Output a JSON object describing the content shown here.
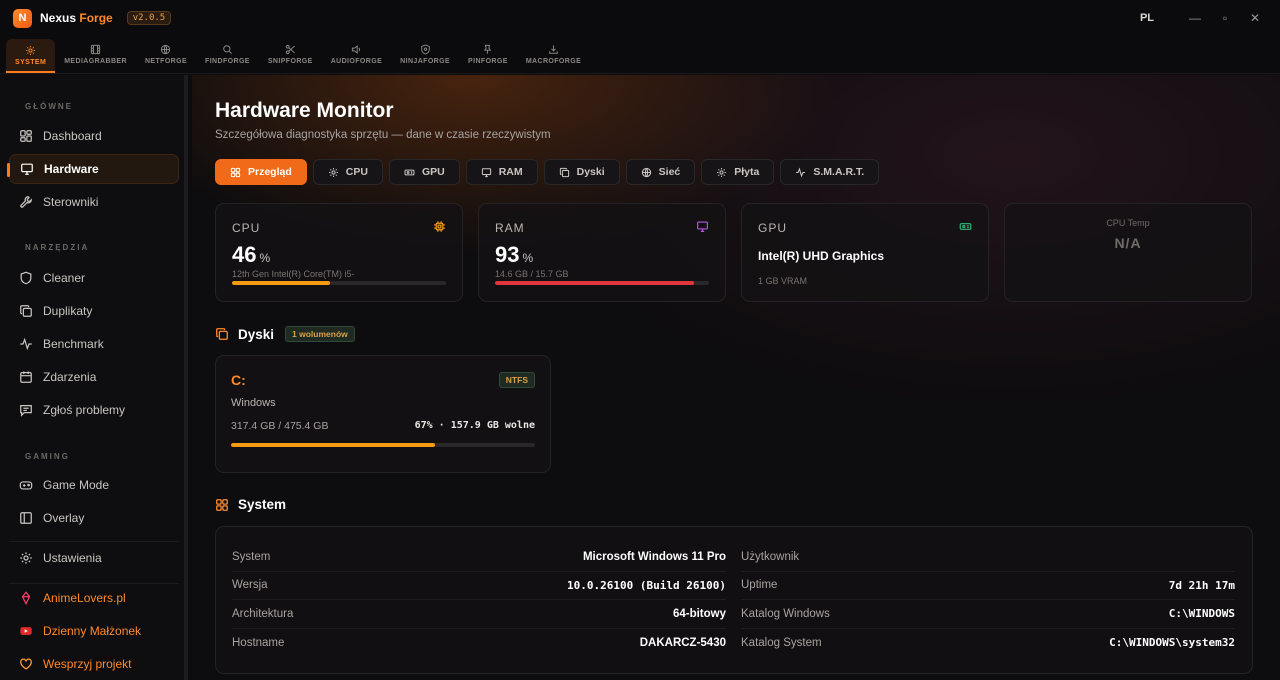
{
  "app": {
    "logo_letter": "N",
    "name_part1": "Nexus",
    "name_part2": "Forge",
    "version": "v2.0.5",
    "lang": "PL"
  },
  "window": {
    "minimize": "—",
    "maximize": "▫",
    "close": "✕"
  },
  "topnav": [
    {
      "label": "SYSTEM",
      "icon": "gear-icon"
    },
    {
      "label": "MEDIAGRABBER",
      "icon": "film-icon"
    },
    {
      "label": "NETFORGE",
      "icon": "globe-icon"
    },
    {
      "label": "FINDFORGE",
      "icon": "search-icon"
    },
    {
      "label": "SNIPFORGE",
      "icon": "scissors-icon"
    },
    {
      "label": "AUDIOFORGE",
      "icon": "speaker-icon"
    },
    {
      "label": "NINJAFORGE",
      "icon": "shield-icon"
    },
    {
      "label": "PINFORGE",
      "icon": "pin-icon"
    },
    {
      "label": "MACROFORGE",
      "icon": "download-icon"
    }
  ],
  "sidebar": {
    "sec_main": "GŁÓWNE",
    "sec_tools": "NARZĘDZIA",
    "sec_gaming": "GAMING",
    "items": {
      "dashboard": "Dashboard",
      "hardware": "Hardware",
      "drivers": "Sterowniki",
      "cleaner": "Cleaner",
      "duplicates": "Duplikaty",
      "benchmark": "Benchmark",
      "events": "Zdarzenia",
      "report": "Zgłoś problemy",
      "gamemode": "Game Mode",
      "overlay": "Overlay",
      "settings": "Ustawienia",
      "animelovers": "AnimeLovers.pl",
      "dzienny": "Dzienny Małżonek",
      "support": "Wesprzyj projekt"
    }
  },
  "main": {
    "title": "Hardware Monitor",
    "subtitle": "Szczegółowa diagnostyka sprzętu — dane w czasie rzeczywistym",
    "tabs": {
      "overview": "Przegląd",
      "cpu": "CPU",
      "gpu": "GPU",
      "ram": "RAM",
      "disks": "Dyski",
      "network": "Sieć",
      "board": "Płyta",
      "smart": "S.M.A.R.T."
    }
  },
  "cards": {
    "cpu": {
      "label": "CPU",
      "value": "46",
      "unit": "%",
      "sub": "12th Gen Intel(R) Core(TM) i5-",
      "percent": 46
    },
    "ram": {
      "label": "RAM",
      "value": "93",
      "unit": "%",
      "sub": "14.6 GB / 15.7 GB",
      "percent": 93
    },
    "gpu": {
      "label": "GPU",
      "name": "Intel(R) UHD Graphics",
      "sub": "1 GB VRAM"
    },
    "temp": {
      "label": "CPU Temp",
      "value": "N/A"
    }
  },
  "disks": {
    "title": "Dyski",
    "badge": "1 wolumenów",
    "items": [
      {
        "letter": "C:",
        "fs": "NTFS",
        "name": "Windows",
        "used": "317.4 GB / 475.4 GB",
        "free": "67% · 157.9 GB wolne",
        "percent": 67
      }
    ]
  },
  "system": {
    "title": "System",
    "left": [
      {
        "key": "System",
        "val": "Microsoft Windows 11 Pro"
      },
      {
        "key": "Wersja",
        "val": "10.0.26100 (Build 26100)"
      },
      {
        "key": "Architektura",
        "val": "64-bitowy"
      },
      {
        "key": "Hostname",
        "val": "DAKARCZ-5430"
      }
    ],
    "right": [
      {
        "key": "Użytkownik",
        "val": ""
      },
      {
        "key": "Uptime",
        "val": "7d 21h 17m"
      },
      {
        "key": "Katalog Windows",
        "val": "C:\\WINDOWS"
      },
      {
        "key": "Katalog System",
        "val": "C:\\WINDOWS\\system32"
      }
    ]
  },
  "colors": {
    "accent": "#ff7a1a",
    "cpu_bar": "#f59a12",
    "ram_bar": "#e0363a",
    "disk_bar": "#f59a12"
  }
}
